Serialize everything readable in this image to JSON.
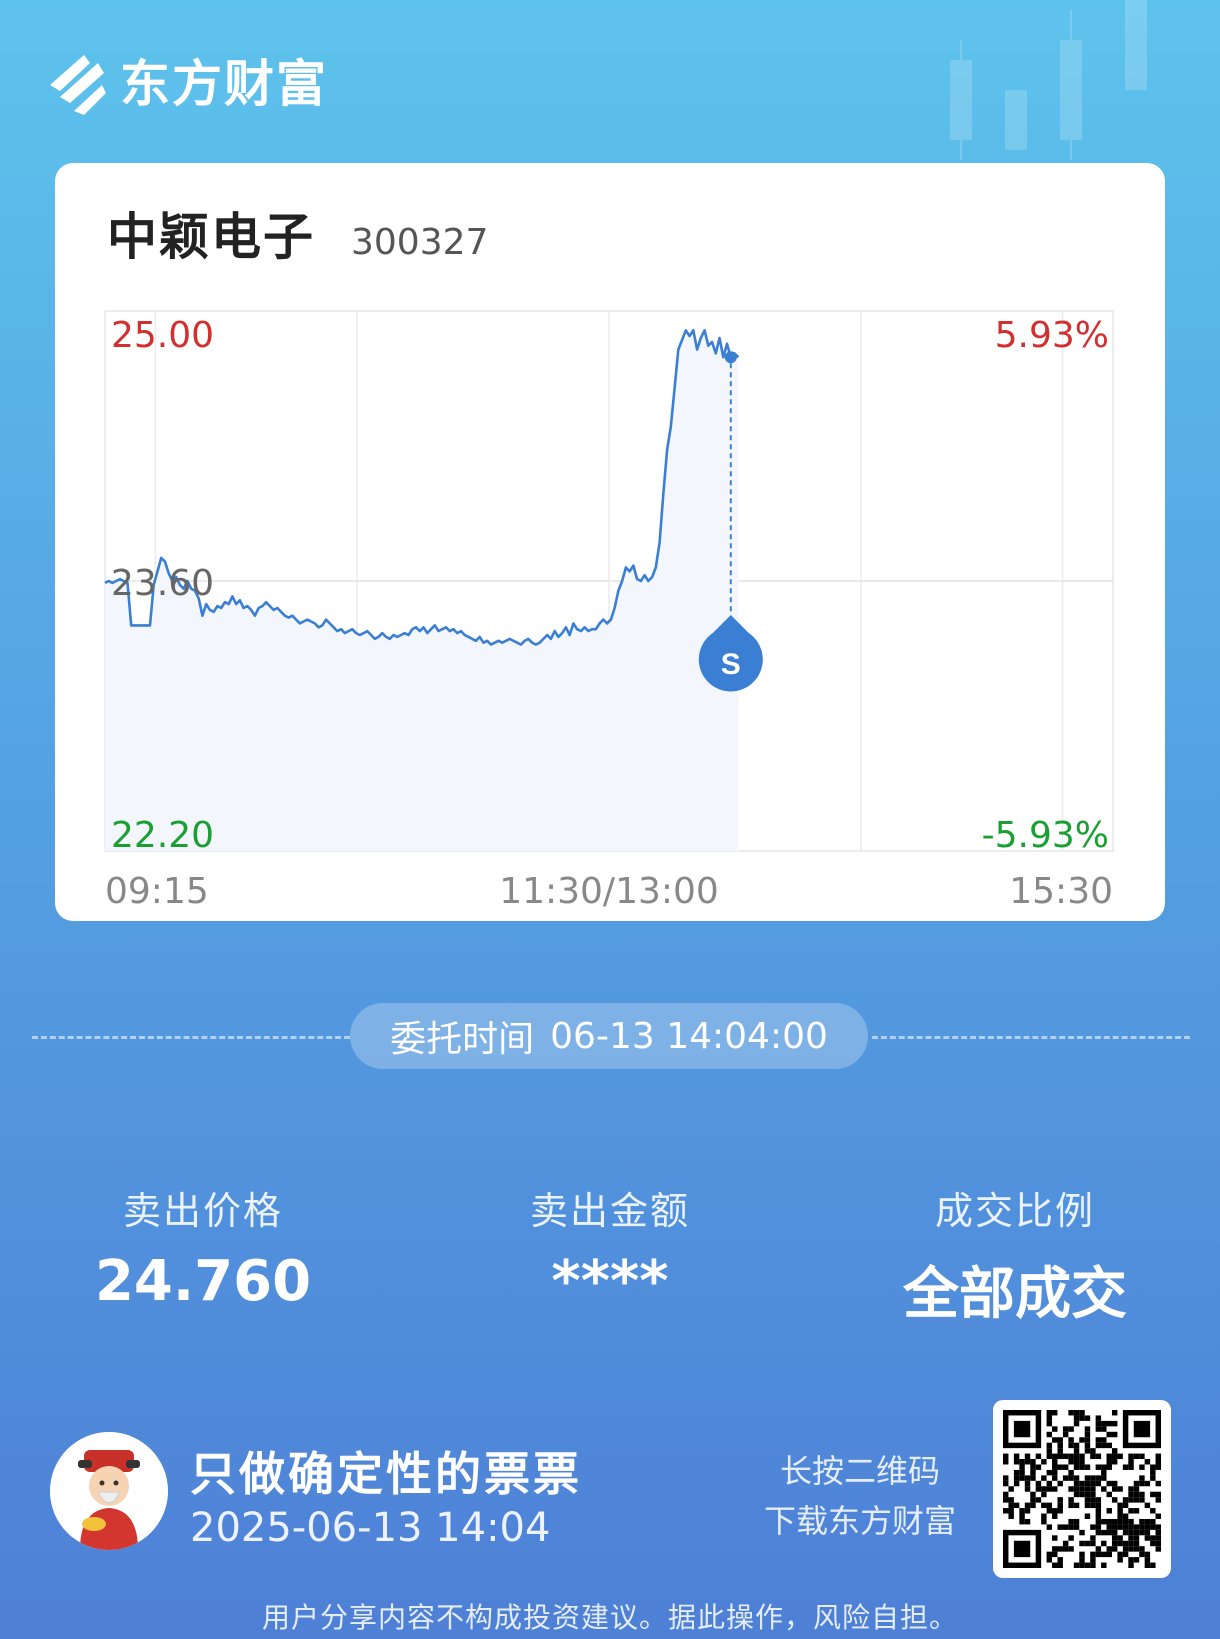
{
  "brand": {
    "name": "东方财富"
  },
  "stock": {
    "name": "中颖电子",
    "code": "300327"
  },
  "chart_data": {
    "type": "line",
    "y_left_labels": {
      "top": "25.00",
      "mid": "23.60",
      "bottom": "22.20"
    },
    "y_right_labels": {
      "top": "5.93%",
      "bottom": "-5.93%"
    },
    "x_labels": {
      "start": "09:15",
      "mid": "11:30/13:00",
      "end": "15:30"
    },
    "ylim": [
      22.2,
      25.0
    ],
    "prev_close": 23.6,
    "grid": true,
    "marker": {
      "label": "S",
      "type": "sell",
      "time_index": 167,
      "price": 24.76
    },
    "series": [
      {
        "color": "#3b7fd4",
        "values": [
          23.59,
          23.6,
          23.59,
          23.6,
          23.61,
          23.6,
          23.59,
          23.37,
          23.37,
          23.37,
          23.37,
          23.37,
          23.37,
          23.58,
          23.65,
          23.72,
          23.7,
          23.64,
          23.6,
          23.62,
          23.58,
          23.56,
          23.6,
          23.56,
          23.55,
          23.51,
          23.42,
          23.48,
          23.45,
          23.44,
          23.47,
          23.46,
          23.49,
          23.48,
          23.52,
          23.48,
          23.5,
          23.46,
          23.47,
          23.45,
          23.42,
          23.46,
          23.47,
          23.49,
          23.47,
          23.45,
          23.46,
          23.44,
          23.42,
          23.41,
          23.42,
          23.4,
          23.38,
          23.39,
          23.4,
          23.39,
          23.38,
          23.36,
          23.37,
          23.4,
          23.38,
          23.36,
          23.34,
          23.35,
          23.33,
          23.34,
          23.35,
          23.33,
          23.32,
          23.33,
          23.34,
          23.32,
          23.3,
          23.31,
          23.33,
          23.31,
          23.3,
          23.32,
          23.31,
          23.32,
          23.33,
          23.32,
          23.35,
          23.36,
          23.34,
          23.36,
          23.33,
          23.35,
          23.37,
          23.34,
          23.35,
          23.36,
          23.34,
          23.35,
          23.33,
          23.34,
          23.32,
          23.31,
          23.3,
          23.29,
          23.31,
          23.28,
          23.29,
          23.27,
          23.28,
          23.29,
          23.28,
          23.29,
          23.3,
          23.29,
          23.28,
          23.27,
          23.29,
          23.3,
          23.28,
          23.27,
          23.28,
          23.3,
          23.32,
          23.3,
          23.34,
          23.31,
          23.33,
          23.36,
          23.32,
          23.38,
          23.35,
          23.34,
          23.36,
          23.34,
          23.35,
          23.35,
          23.38,
          23.4,
          23.38,
          23.4,
          23.46,
          23.55,
          23.6,
          23.67,
          23.65,
          23.68,
          23.61,
          23.6,
          23.63,
          23.6,
          23.62,
          23.67,
          23.8,
          24.05,
          24.28,
          24.4,
          24.6,
          24.8,
          24.85,
          24.9,
          24.87,
          24.9,
          24.8,
          24.86,
          24.9,
          24.82,
          24.84,
          24.78,
          24.86,
          24.76,
          24.83,
          24.76,
          24.78,
          24.76
        ]
      }
    ]
  },
  "order": {
    "label": "委托时间",
    "time": "06-13 14:04:00"
  },
  "stats": [
    {
      "label": "卖出价格",
      "value": "24.760"
    },
    {
      "label": "卖出金额",
      "value": "****"
    },
    {
      "label": "成交比例",
      "value": "全部成交"
    }
  ],
  "footer": {
    "slogan": "只做确定性的票票",
    "datetime": "2025-06-13 14:04",
    "qr_hint_line1": "长按二维码",
    "qr_hint_line2": "下载东方财富",
    "disclaimer": "用户分享内容不构成投资建议。据此操作，风险自担。"
  },
  "colors": {
    "up": "#d23030",
    "down": "#1aa032",
    "line": "#3b7fd4",
    "neutral": "#666666"
  }
}
